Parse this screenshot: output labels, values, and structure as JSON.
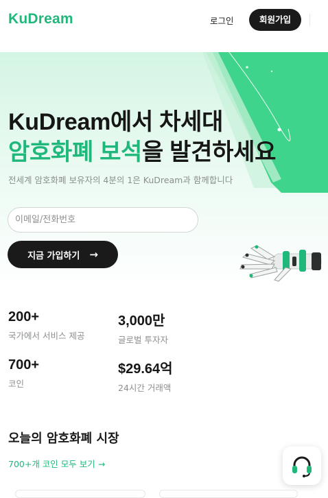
{
  "header": {
    "logo": "KuDream",
    "login_label": "로그인",
    "signup_label": "회원가입"
  },
  "hero": {
    "headline_line1": "KuDream에서 차세대",
    "headline_accent": "암호화폐 보석",
    "headline_rest": "을 발견하세요",
    "subtitle": "전세계 암호화폐 보유자의 4분의 1은 KuDream과 함께합니다",
    "email_placeholder": "이메일/전화번호",
    "cta_label": "지금 가입하기",
    "cta_arrow": "→"
  },
  "stats": [
    {
      "value": "200+",
      "label": "국가에서 서비스 제공"
    },
    {
      "value": "3,000만",
      "label": "글로벌 투자자"
    },
    {
      "value": "700+",
      "label": "코인"
    },
    {
      "value": "$29.64억",
      "label": "24시간 거래액"
    }
  ],
  "market": {
    "title": "오늘의 암호화폐 시장",
    "view_all": "700+개 코인 모두 보기 →"
  },
  "icons": {
    "support": "headset-icon",
    "cta_arrow": "arrow-right-icon"
  },
  "colors": {
    "accent": "#1fb87a",
    "dark": "#1a1a1a",
    "hero_band": "#3ed38a"
  }
}
